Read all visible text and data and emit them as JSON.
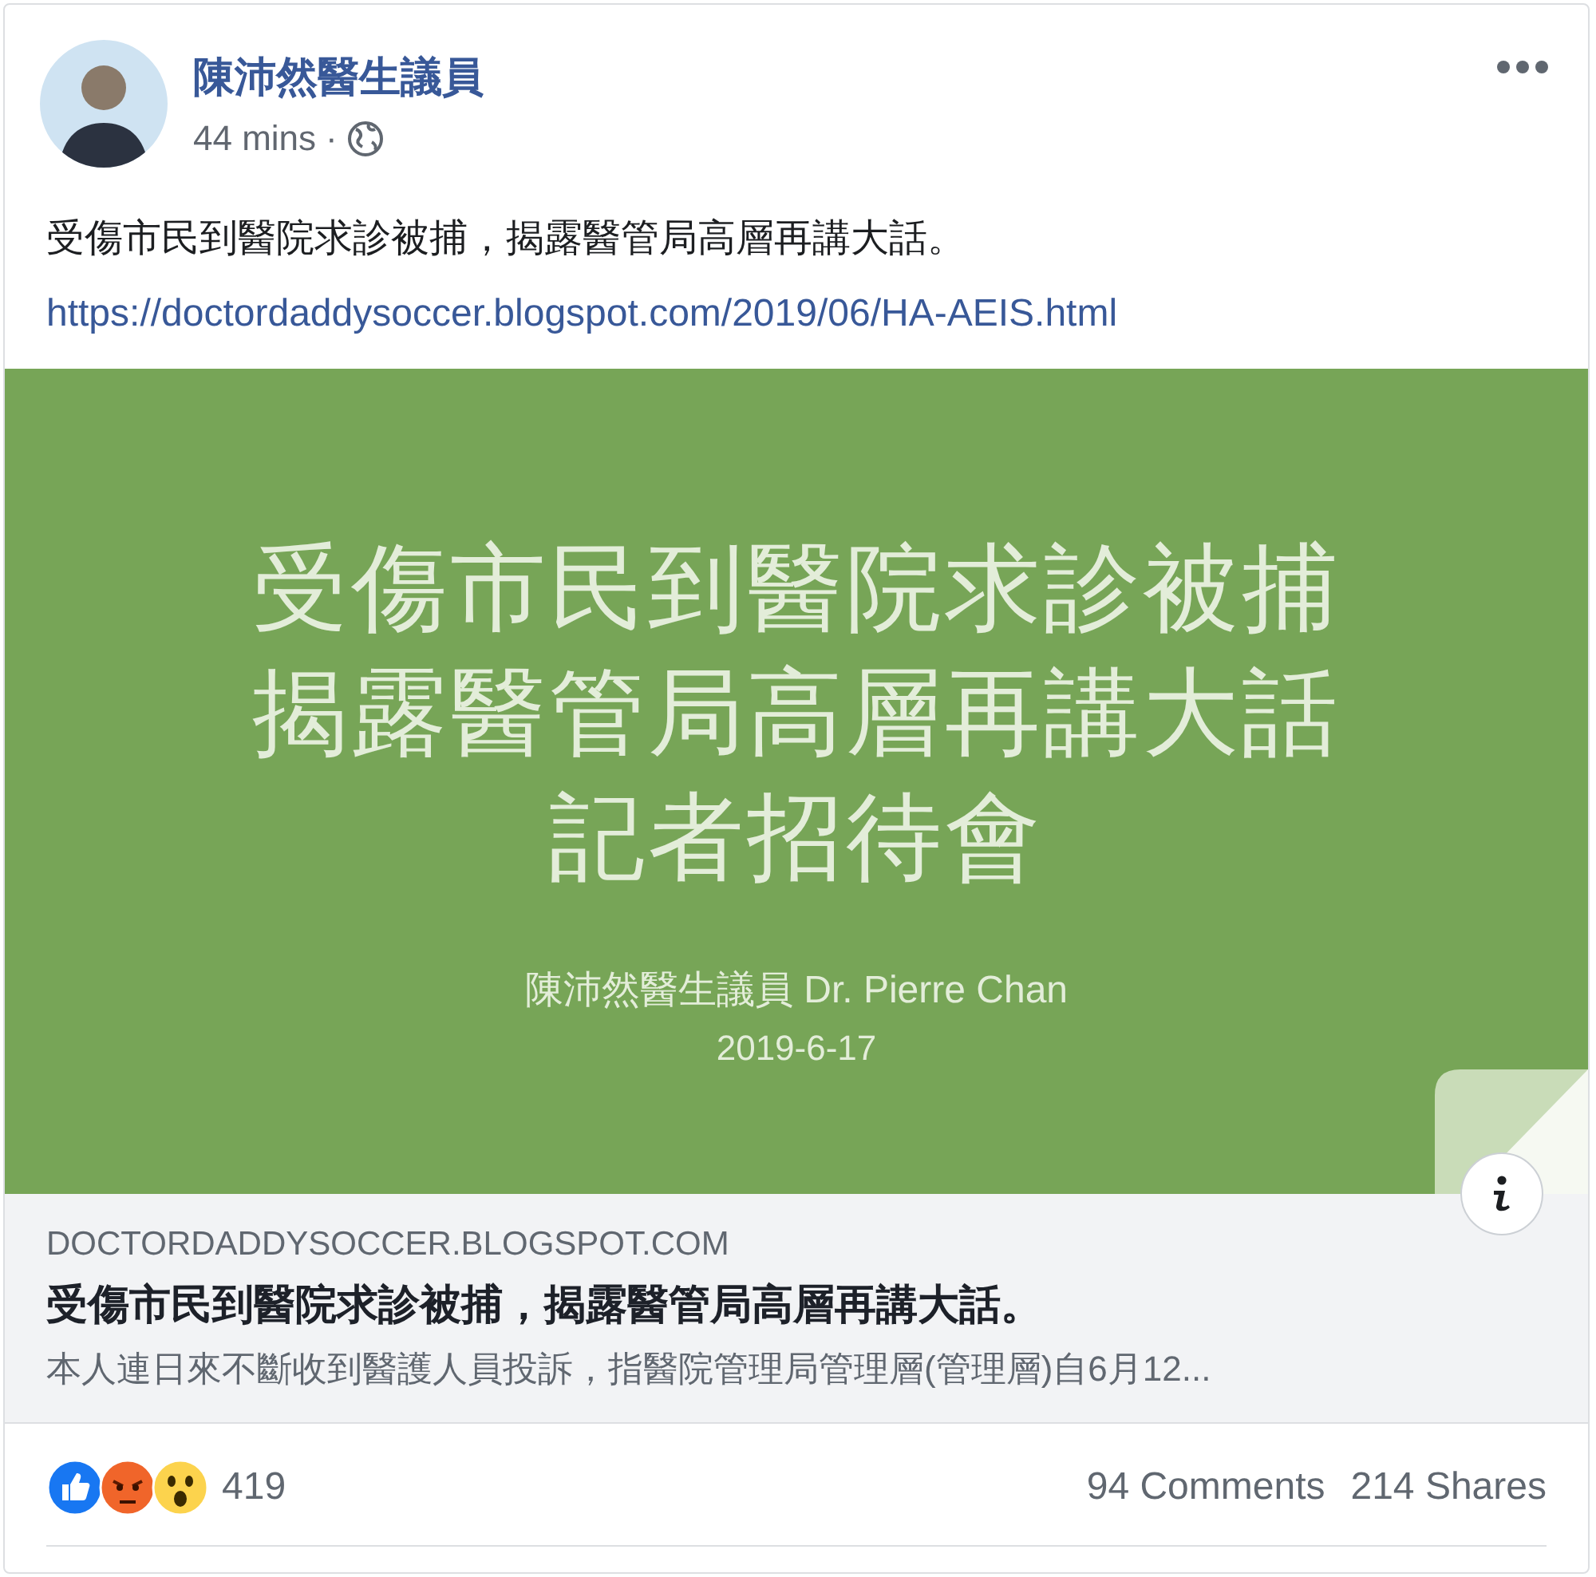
{
  "post": {
    "author": "陳沛然醫生議員",
    "time": "44 mins",
    "separator": "·",
    "text": "受傷市民到醫院求診被捕，揭露醫管局高層再講大話。",
    "link": "https://doctordaddysoccer.blogspot.com/2019/06/HA-AEIS.html"
  },
  "slide": {
    "lines": [
      "受傷市民到醫院求診被捕",
      "揭露醫管局高層再講大話",
      "記者招待會"
    ],
    "byline": "陳沛然醫生議員 Dr. Pierre Chan",
    "date": "2019-6-17"
  },
  "preview": {
    "domain": "DOCTORDADDYSOCCER.BLOGSPOT.COM",
    "title": "受傷市民到醫院求診被捕，揭露醫管局高層再講大話。",
    "description": "本人連日來不斷收到醫護人員投訴，指醫院管理局管理層(管理層)自6月12..."
  },
  "footer": {
    "reactions": [
      {
        "kind": "like"
      },
      {
        "kind": "angry"
      },
      {
        "kind": "wow"
      }
    ],
    "reaction_count": "419",
    "comments": "94 Comments",
    "shares": "214 Shares"
  }
}
